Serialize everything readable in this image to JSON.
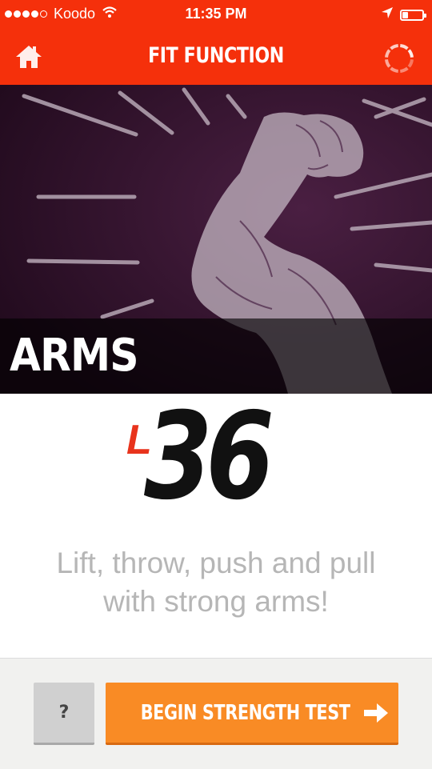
{
  "status_bar": {
    "carrier": "Koodo",
    "time": "11:35 PM",
    "signal_bars_filled": 4,
    "signal_bars_total": 5,
    "battery_level": 0.3,
    "icons": [
      "signal-dots-icon",
      "wifi-icon",
      "location-arrow-icon",
      "battery-icon"
    ]
  },
  "nav": {
    "title": "FIT FUNCTION",
    "left_icon": "home-icon",
    "right_icon": "loading-spinner-icon"
  },
  "hero": {
    "title": "ARMS",
    "image": "flexed-arm-illustration"
  },
  "level": {
    "prefix": "L",
    "number": "36"
  },
  "description": "Lift, throw, push and pull with strong arms!",
  "footer": {
    "help_label": "?",
    "begin_label": "BEGIN STRENGTH TEST",
    "begin_icon": "arrow-right-icon"
  },
  "colors": {
    "brand_red": "#f5300b",
    "accent_orange": "#f98b25",
    "hero_background": "#2a0f24",
    "level_prefix_red": "#e8331c"
  }
}
